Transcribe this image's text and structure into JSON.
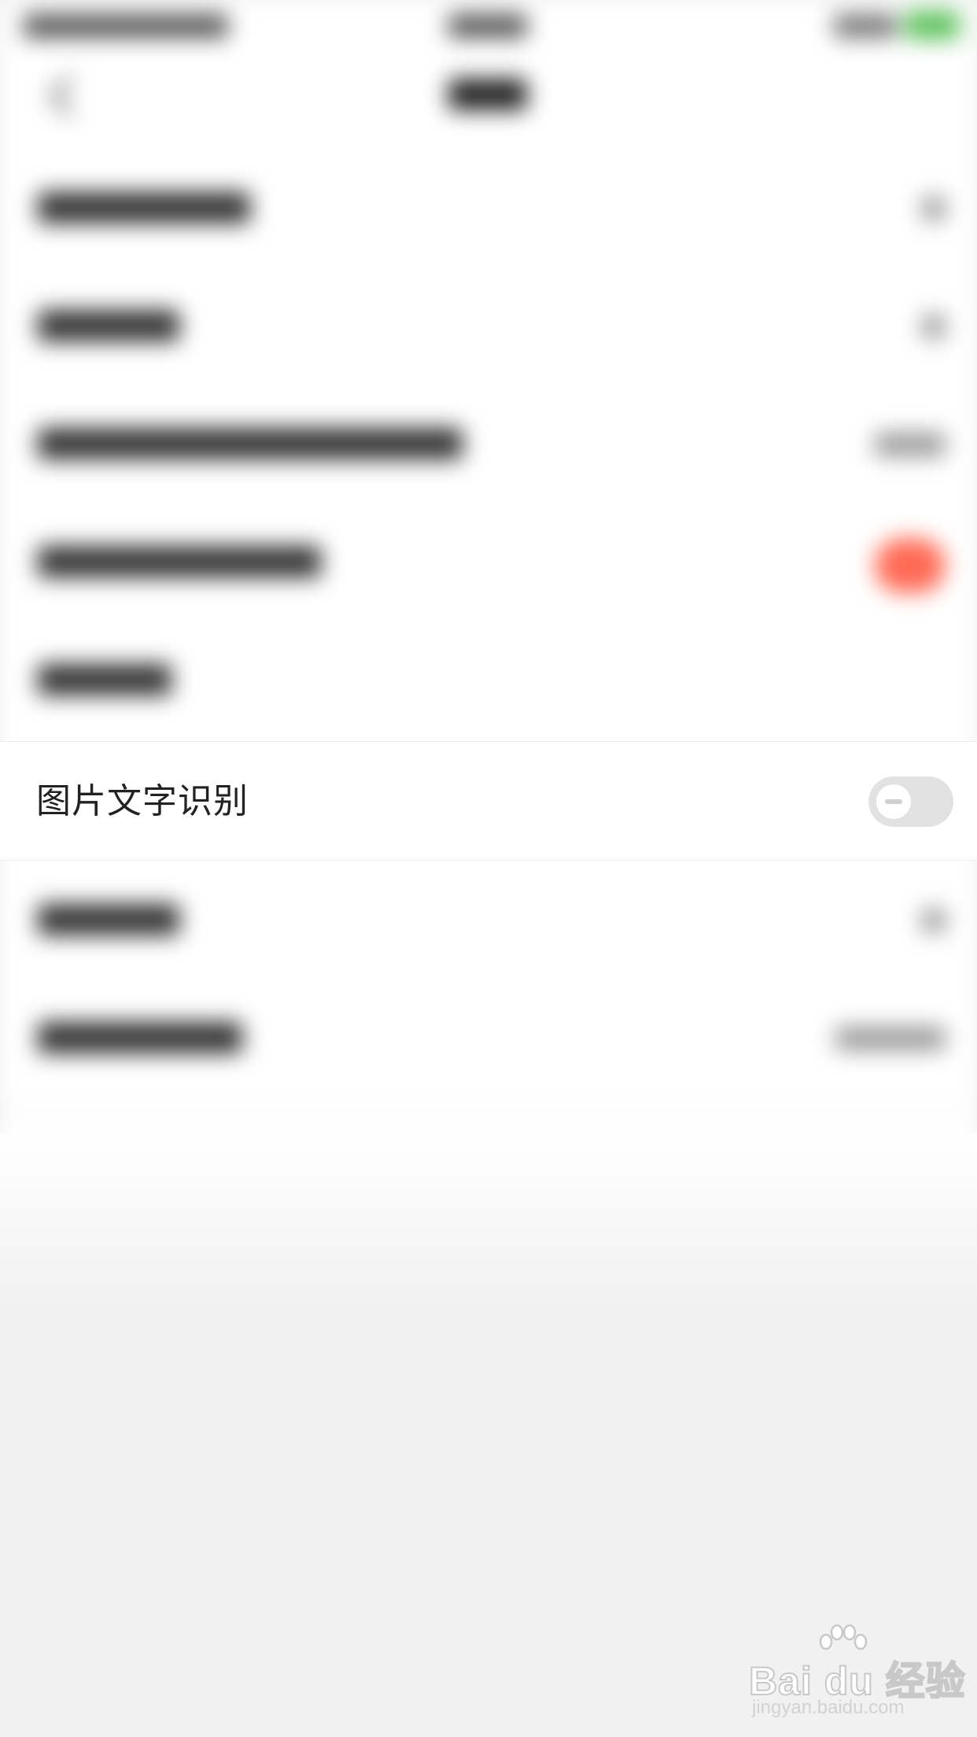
{
  "settings": {
    "focused_item": {
      "label": "图片文字识别",
      "toggle_on": false
    }
  },
  "watermark": {
    "logo_text": "Bai du 经验",
    "url": "jingyan.baidu.com"
  },
  "colors": {
    "page_background": "#f1f1f1",
    "row_background": "#ffffff",
    "toggle_off_track": "#e2e2e2",
    "badge_red": "#ff6a55"
  }
}
